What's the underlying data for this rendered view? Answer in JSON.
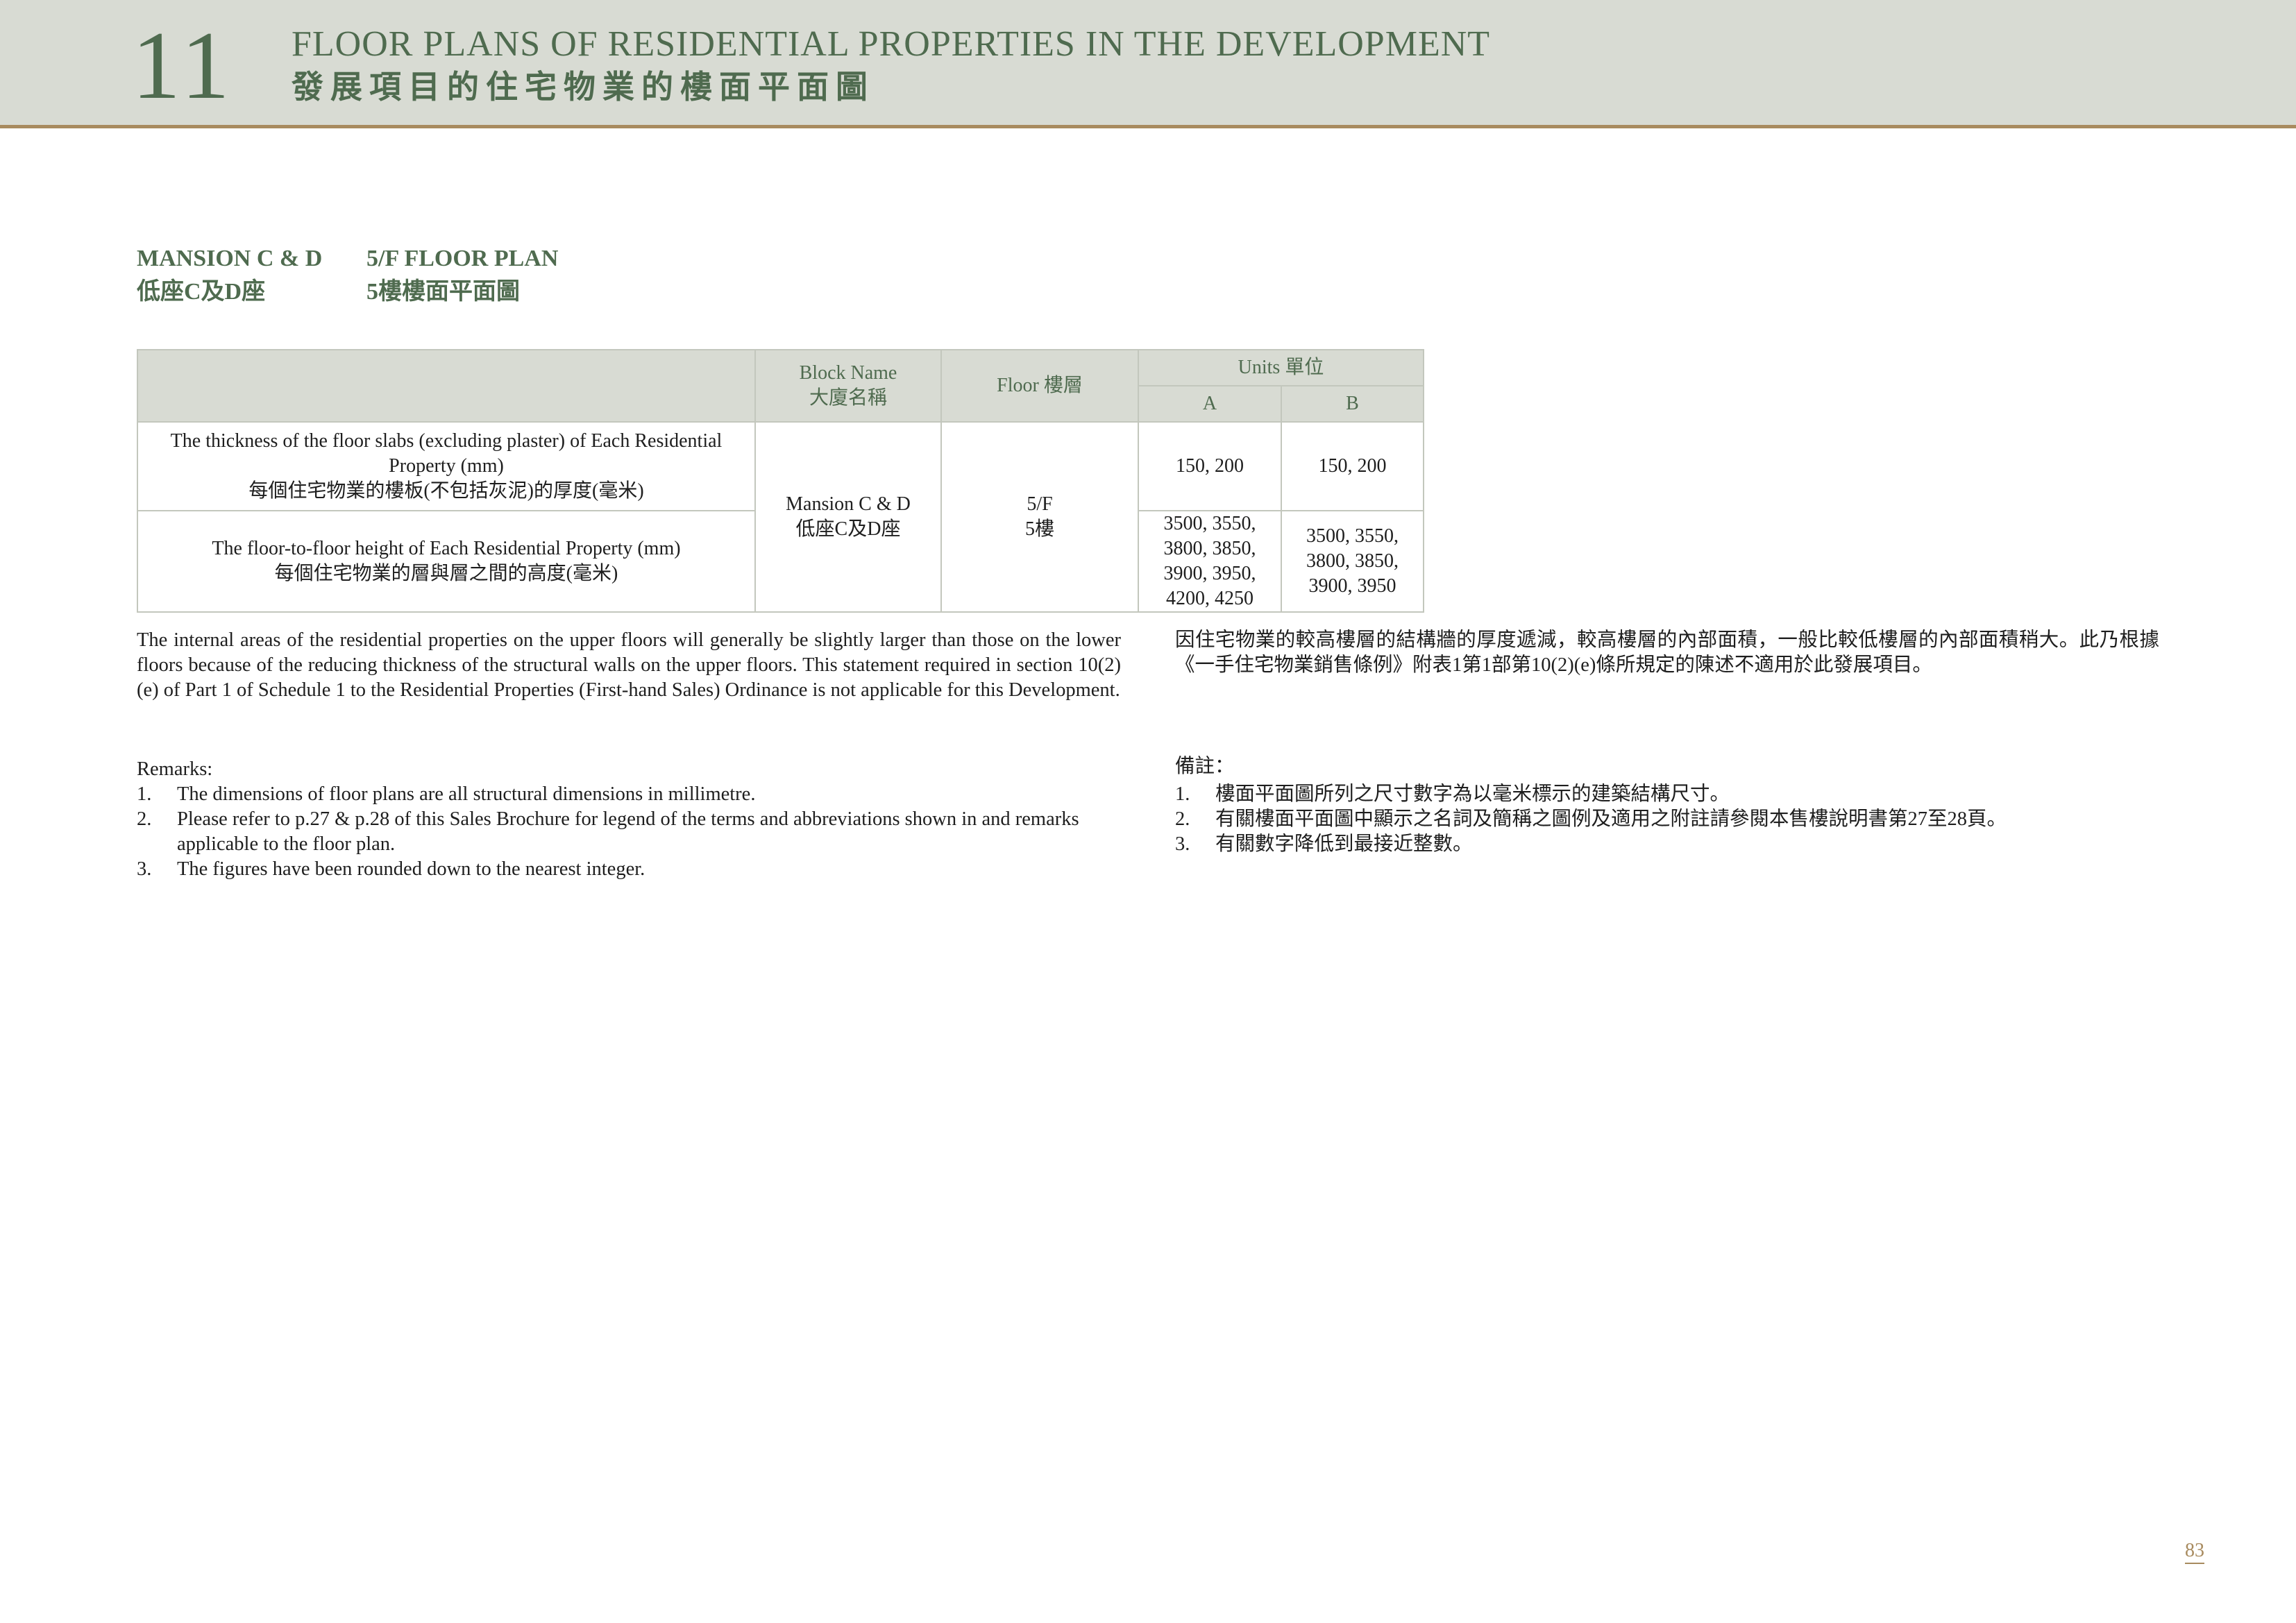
{
  "header": {
    "chapter": "11",
    "title_en": "FLOOR PLANS OF RESIDENTIAL PROPERTIES IN THE DEVELOPMENT",
    "title_zh": "發展項目的住宅物業的樓面平面圖"
  },
  "section": {
    "block_en": "MANSION C & D",
    "block_zh": "低座C及D座",
    "plan_en": "5/F FLOOR PLAN",
    "plan_zh": "5樓樓面平面圖"
  },
  "table": {
    "head_block_en": "Block Name",
    "head_block_zh": "大廈名稱",
    "head_floor": "Floor 樓層",
    "head_units": "Units 單位",
    "unit_a": "A",
    "unit_b": "B",
    "row1_label_en": "The thickness of the floor slabs (excluding plaster) of Each Residential Property (mm)",
    "row1_label_zh": "每個住宅物業的樓板(不包括灰泥)的厚度(毫米)",
    "row2_label_en": "The floor-to-floor height of Each Residential Property (mm)",
    "row2_label_zh": "每個住宅物業的層與層之間的高度(毫米)",
    "block_value_en": "Mansion C & D",
    "block_value_zh": "低座C及D座",
    "floor_value_en": "5/F",
    "floor_value_zh": "5樓",
    "row1_a": "150, 200",
    "row1_b": "150, 200",
    "row2_a": "3500, 3550, 3800, 3850, 3900, 3950, 4200, 4250",
    "row2_b": "3500, 3550, 3800, 3850, 3900, 3950"
  },
  "statement": {
    "en": "The internal areas of the residential properties on the upper floors will generally be slightly larger than those on the lower floors because of the reducing thickness of the structural walls on the upper floors. This statement required in section 10(2)(e) of Part 1 of Schedule 1 to the Residential Properties (First-hand Sales) Ordinance is not applicable for this Development.",
    "zh": "因住宅物業的較高樓層的結構牆的厚度遞減，較高樓層的內部面積，一般比較低樓層的內部面積稍大。此乃根據《一手住宅物業銷售條例》附表1第1部第10(2)(e)條所規定的陳述不適用於此發展項目。"
  },
  "remarks": {
    "title_en": "Remarks:",
    "title_zh": "備註：",
    "items_en": [
      {
        "n": "1.",
        "text": "The dimensions of floor plans are all structural dimensions in millimetre."
      },
      {
        "n": "2.",
        "text": "Please refer to p.27 & p.28 of this Sales Brochure for legend of the terms and abbreviations shown in and remarks applicable to the floor plan."
      },
      {
        "n": "3.",
        "text": "The figures have been rounded down to the nearest integer."
      }
    ],
    "items_zh": [
      {
        "n": "1.",
        "text": "樓面平面圖所列之尺寸數字為以毫米標示的建築結構尺寸。"
      },
      {
        "n": "2.",
        "text": "有關樓面平面圖中顯示之名詞及簡稱之圖例及適用之附註請參閱本售樓說明書第27至28頁。"
      },
      {
        "n": "3.",
        "text": "有關數字降低到最接近整數。"
      }
    ]
  },
  "page_number": "83"
}
